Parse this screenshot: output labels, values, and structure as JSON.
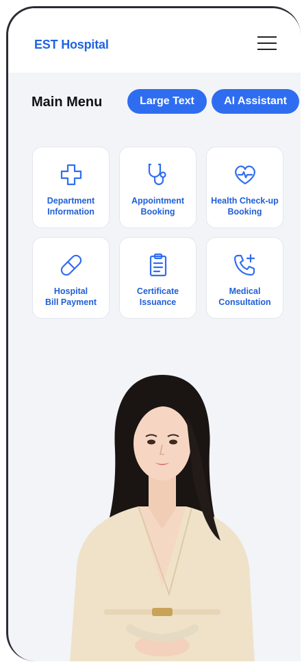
{
  "header": {
    "brand": "EST Hospital",
    "menu_icon": "hamburger-icon"
  },
  "main": {
    "title": "Main Menu",
    "buttons": {
      "large_text": "Large Text",
      "ai_assistant": "AI Assistant"
    },
    "tiles": [
      {
        "label": "Department\nInformation",
        "icon": "medical-cross-icon"
      },
      {
        "label": "Appointment\nBooking",
        "icon": "stethoscope-icon"
      },
      {
        "label": "Health Check-up\nBooking",
        "icon": "heart-pulse-icon"
      },
      {
        "label": "Hospital\nBill Payment",
        "icon": "pill-icon"
      },
      {
        "label": "Certificate\nIssuance",
        "icon": "clipboard-icon"
      },
      {
        "label": "Medical\nConsultation",
        "icon": "phone-plus-icon"
      }
    ]
  },
  "colors": {
    "accent": "#2f6df0",
    "brand": "#1f63e3",
    "background": "#f2f4f8"
  }
}
